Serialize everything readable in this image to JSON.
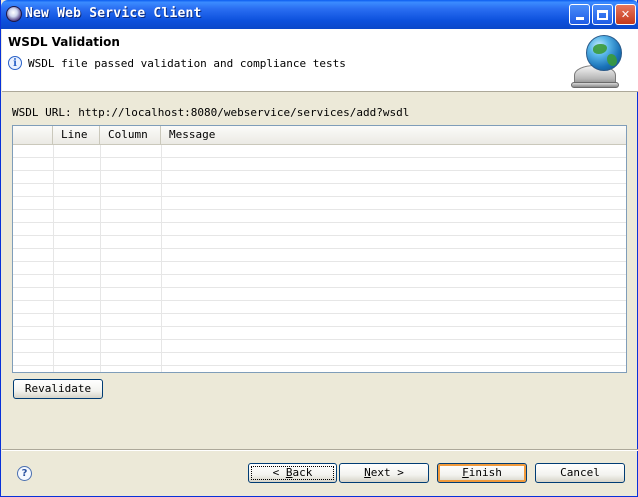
{
  "window": {
    "title": "New Web Service Client",
    "controls": [
      "minimize-icon",
      "maximize-icon",
      "close-icon"
    ]
  },
  "header": {
    "title": "WSDL Validation",
    "message": "WSDL file passed validation and compliance tests",
    "icon": "info-icon",
    "banner_icon": "globe-bell-icon"
  },
  "body": {
    "wsdl_url_label": "WSDL URL: http://localhost:8080/webservice/services/add?wsdl"
  },
  "table": {
    "columns": [
      "",
      "Line",
      "Column",
      "Message"
    ],
    "rows": []
  },
  "buttons": {
    "revalidate": "Revalidate",
    "back_arrow": "<",
    "back_mnemonic": "B",
    "back_rest": "ack",
    "next_mnemonic": "N",
    "next_rest": "ext",
    "next_arrow": ">",
    "finish_mnemonic": "F",
    "finish_rest": "inish",
    "cancel": "Cancel"
  },
  "footer": {
    "help_icon": "help-icon"
  }
}
